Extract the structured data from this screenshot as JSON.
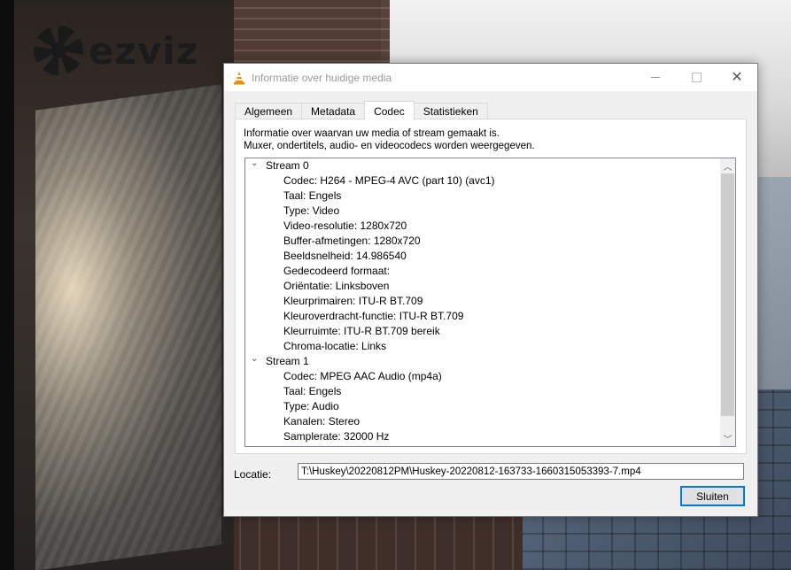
{
  "background": {
    "logo_text": "ezviz"
  },
  "window": {
    "title": "Informatie over huidige media"
  },
  "tabs": [
    {
      "label": "Algemeen",
      "active": false
    },
    {
      "label": "Metadata",
      "active": false
    },
    {
      "label": "Codec",
      "active": true
    },
    {
      "label": "Statistieken",
      "active": false
    }
  ],
  "codec": {
    "description_line1": "Informatie over waarvan uw media of stream gemaakt is.",
    "description_line2": "Muxer, ondertitels, audio- en videocodecs worden weergegeven.",
    "streams": [
      {
        "label": "Stream 0",
        "items": [
          "Codec: H264 - MPEG-4 AVC (part 10) (avc1)",
          "Taal: Engels",
          "Type: Video",
          "Video-resolutie: 1280x720",
          "Buffer-afmetingen: 1280x720",
          "Beeldsnelheid: 14.986540",
          "Gedecodeerd formaat:",
          "Oriëntatie: Linksboven",
          "Kleurprimairen: ITU-R BT.709",
          "Kleuroverdracht-functie: ITU-R BT.709",
          "Kleurruimte: ITU-R BT.709 bereik",
          "Chroma-locatie: Links"
        ]
      },
      {
        "label": "Stream 1",
        "items": [
          "Codec: MPEG AAC Audio (mp4a)",
          "Taal: Engels",
          "Type: Audio",
          "Kanalen: Stereo",
          "Samplerate: 32000 Hz"
        ]
      }
    ]
  },
  "location": {
    "label": "Locatie:",
    "value": "T:\\Huskey\\20220812PM\\Huskey-20220812-163733-1660315053393-7.mp4"
  },
  "buttons": {
    "close_label": "Sluiten"
  },
  "colors": {
    "accent": "#0078d7",
    "vlc_cone": "#f48b00"
  }
}
